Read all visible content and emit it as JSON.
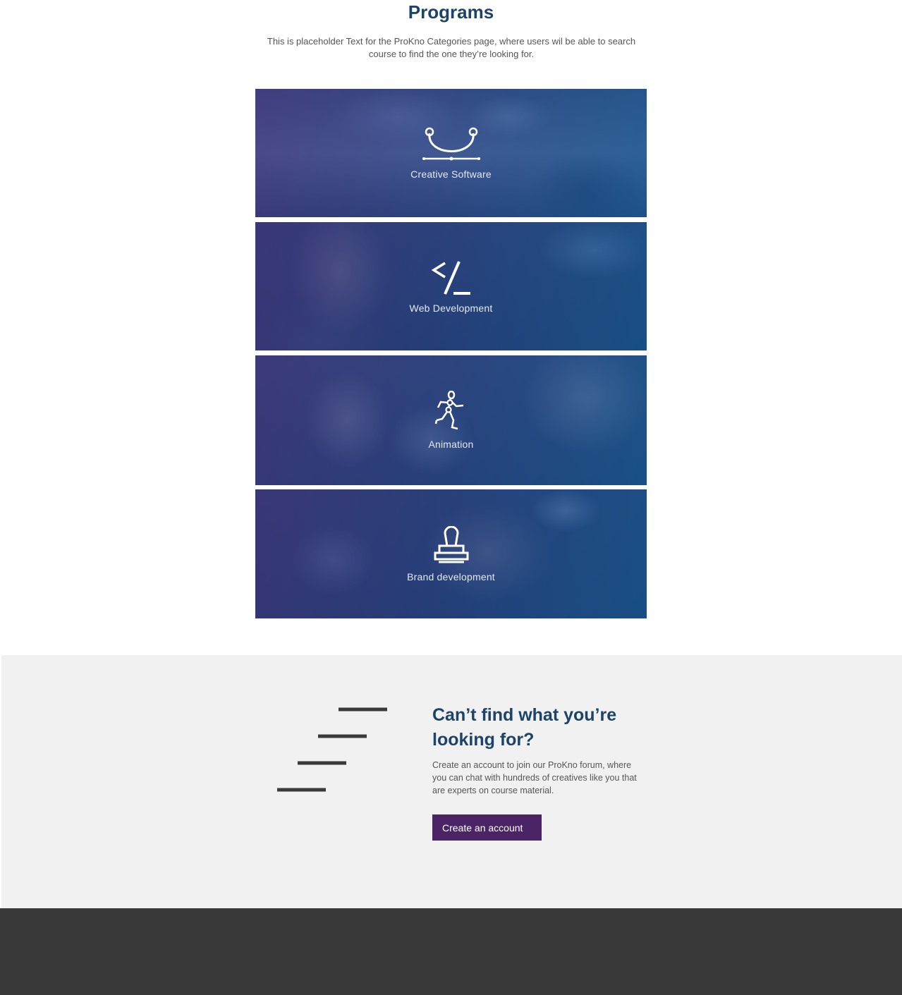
{
  "programs": {
    "title": "Programs",
    "intro": "This is placeholder Text for the ProKno Categories page, where users wil be able to search course to find the one they’re looking for.",
    "cards": [
      {
        "label": "Creative Software",
        "icon": "bezier-curve-icon"
      },
      {
        "label": "Web Development",
        "icon": "code-tag-icon"
      },
      {
        "label": "Animation",
        "icon": "running-figure-icon"
      },
      {
        "label": "Brand development",
        "icon": "stamp-icon"
      }
    ]
  },
  "cta": {
    "title": "Can’t find what you’re looking for?",
    "text": "Create an account to join our ProKno forum, where you can chat with hundreds of creatives like you that are experts on course material.",
    "button_label": "Create an account",
    "icon": "staircase-lines-icon"
  },
  "colors": {
    "heading": "#1d4468",
    "button": "#4a2464",
    "cta_background": "#f1f1f1",
    "footer": "#383838"
  }
}
